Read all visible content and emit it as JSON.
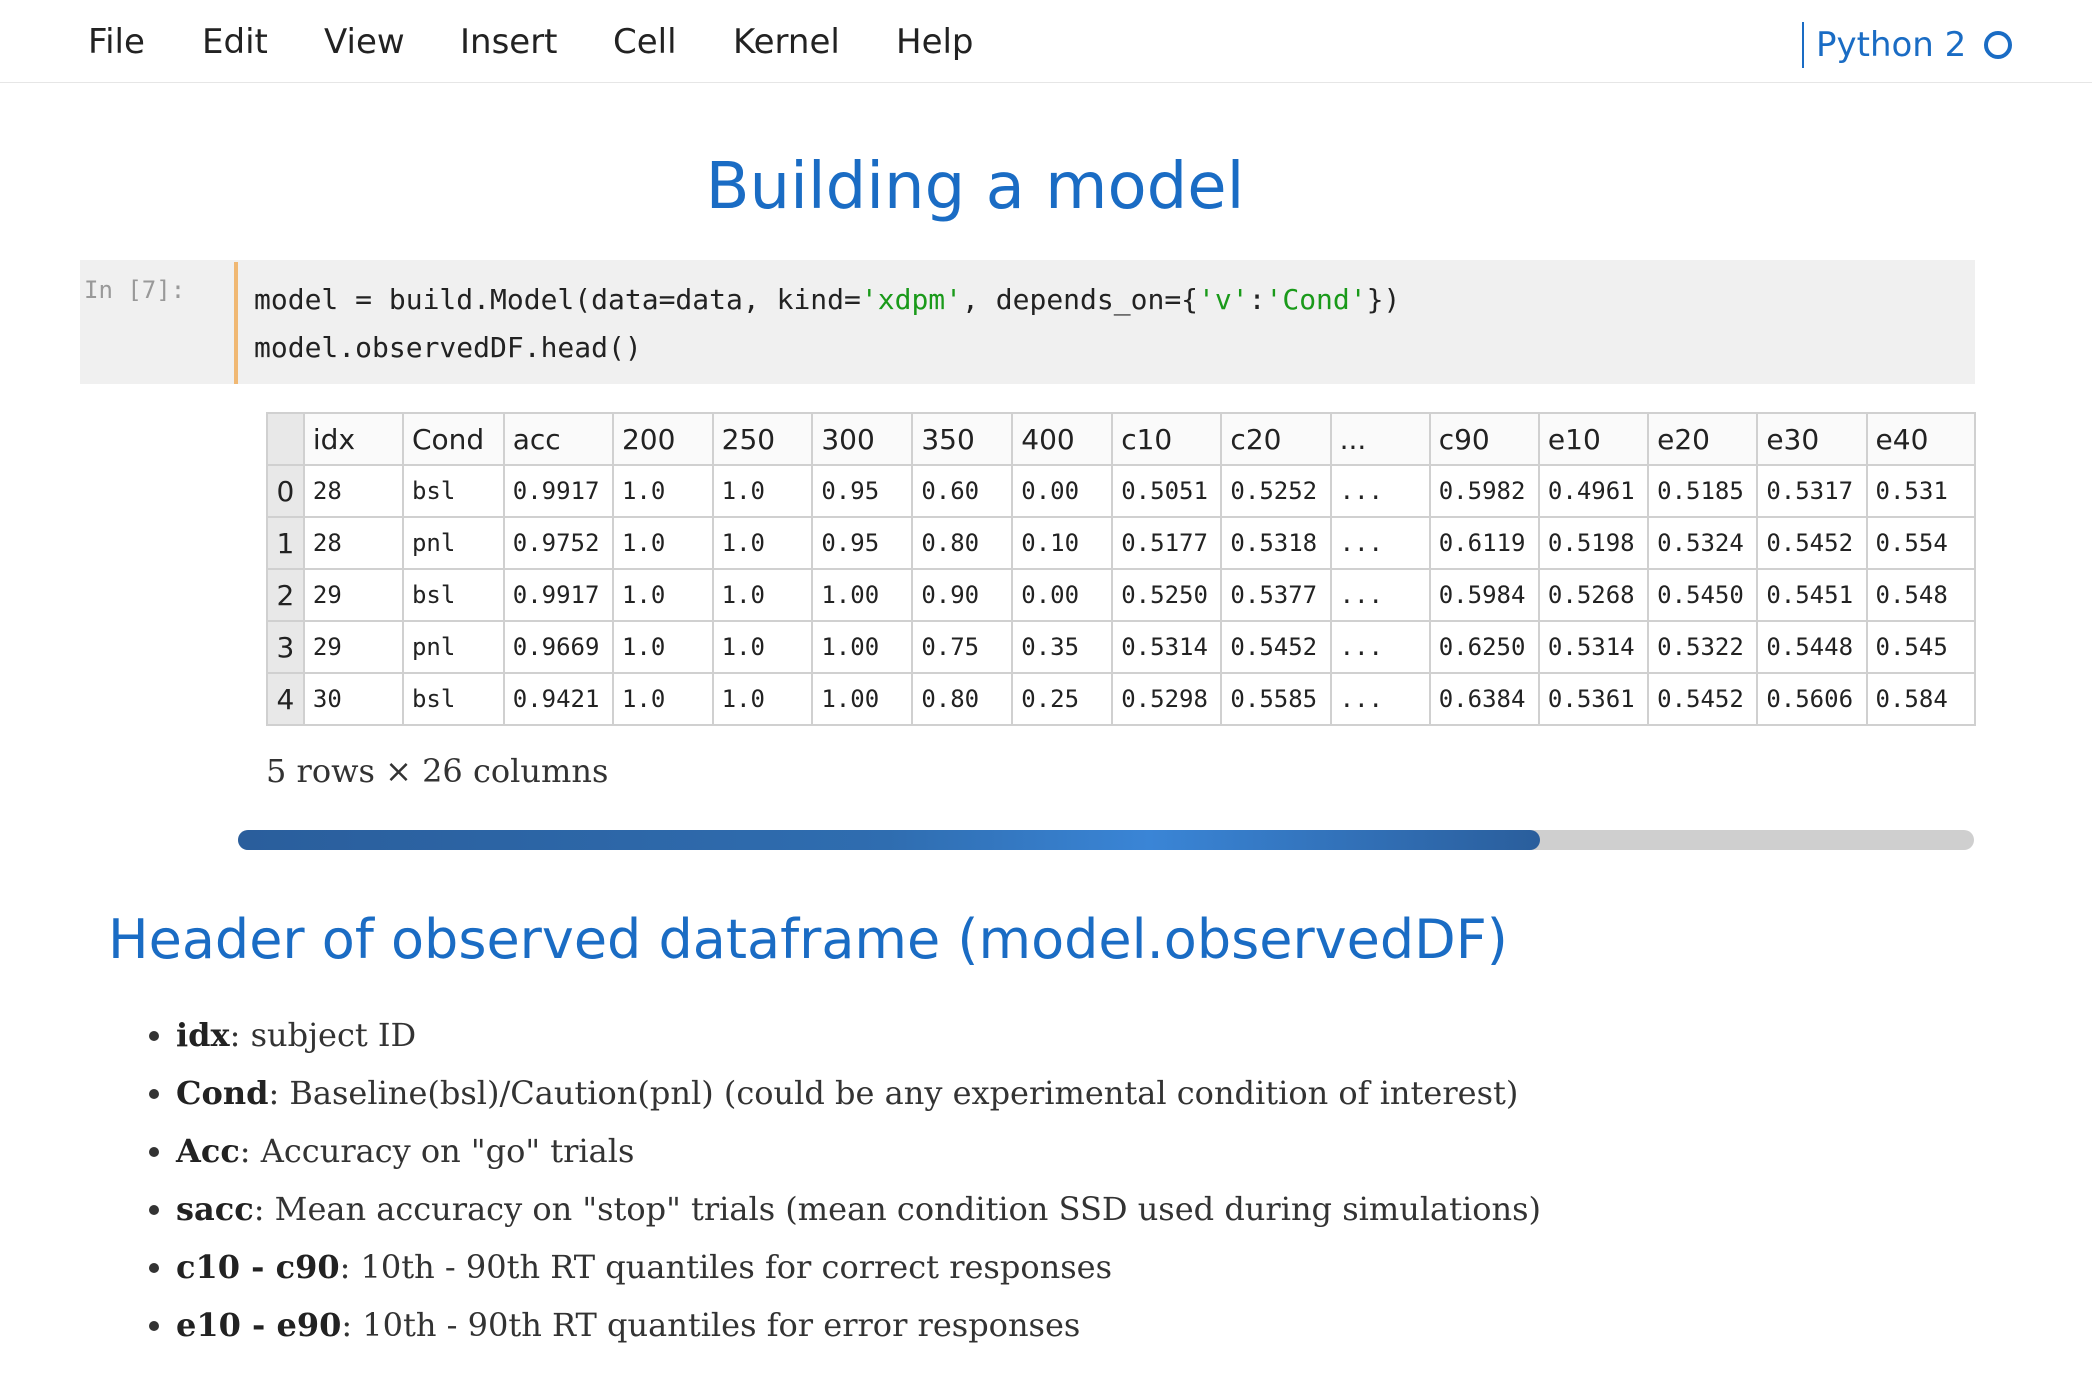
{
  "menu": {
    "items": [
      "File",
      "Edit",
      "View",
      "Insert",
      "Cell",
      "Kernel",
      "Help"
    ],
    "kernel_name": "Python 2"
  },
  "notebook": {
    "title": "Building a model",
    "cell": {
      "prompt": "In [7]:",
      "code": {
        "line1_prefix": "model = build.Model(data=data, kind=",
        "line1_str1": "'xdpm'",
        "line1_mid": ", depends_on={",
        "line1_str2": "'v'",
        "line1_colon": ":",
        "line1_str3": "'Cond'",
        "line1_suffix": "})",
        "line2": "model.observedDF.head()"
      }
    },
    "dataframe": {
      "columns": [
        "idx",
        "Cond",
        "acc",
        "200",
        "250",
        "300",
        "350",
        "400",
        "c10",
        "c20",
        "...",
        "c90",
        "e10",
        "e20",
        "e30",
        "e40"
      ],
      "rows": [
        {
          "index": "0",
          "cells": [
            "28",
            "bsl",
            "0.9917",
            "1.0",
            "1.0",
            "0.95",
            "0.60",
            "0.00",
            "0.5051",
            "0.5252",
            "...",
            "0.5982",
            "0.4961",
            "0.5185",
            "0.5317",
            "0.531"
          ]
        },
        {
          "index": "1",
          "cells": [
            "28",
            "pnl",
            "0.9752",
            "1.0",
            "1.0",
            "0.95",
            "0.80",
            "0.10",
            "0.5177",
            "0.5318",
            "...",
            "0.6119",
            "0.5198",
            "0.5324",
            "0.5452",
            "0.554"
          ]
        },
        {
          "index": "2",
          "cells": [
            "29",
            "bsl",
            "0.9917",
            "1.0",
            "1.0",
            "1.00",
            "0.90",
            "0.00",
            "0.5250",
            "0.5377",
            "...",
            "0.5984",
            "0.5268",
            "0.5450",
            "0.5451",
            "0.548"
          ]
        },
        {
          "index": "3",
          "cells": [
            "29",
            "pnl",
            "0.9669",
            "1.0",
            "1.0",
            "1.00",
            "0.75",
            "0.35",
            "0.5314",
            "0.5452",
            "...",
            "0.6250",
            "0.5314",
            "0.5322",
            "0.5448",
            "0.545"
          ]
        },
        {
          "index": "4",
          "cells": [
            "30",
            "bsl",
            "0.9421",
            "1.0",
            "1.0",
            "1.00",
            "0.80",
            "0.25",
            "0.5298",
            "0.5585",
            "...",
            "0.6384",
            "0.5361",
            "0.5452",
            "0.5606",
            "0.584"
          ]
        }
      ],
      "caption": "5 rows × 26 columns"
    },
    "scrollbar": {
      "position_fraction": 0.75
    },
    "section": {
      "title": "Header of observed dataframe (model.observedDF)",
      "items": [
        {
          "term": "idx",
          "desc": ": subject ID"
        },
        {
          "term": "Cond",
          "desc": ": Baseline(bsl)/Caution(pnl) (could be any experimental condition of interest)"
        },
        {
          "term": "Acc",
          "desc": ": Accuracy on \"go\" trials"
        },
        {
          "term": "sacc",
          "desc": ": Mean accuracy on \"stop\" trials (mean condition SSD used during simulations)"
        },
        {
          "term": "c10 - c90",
          "desc": ": 10th - 90th RT quantiles for correct responses"
        },
        {
          "term": "e10 - e90",
          "desc": ": 10th - 90th RT quantiles for error responses"
        }
      ]
    }
  },
  "colors": {
    "accent": "#1a6cc4",
    "string": "#1a9a1a",
    "cell_border": "#f0b873"
  }
}
